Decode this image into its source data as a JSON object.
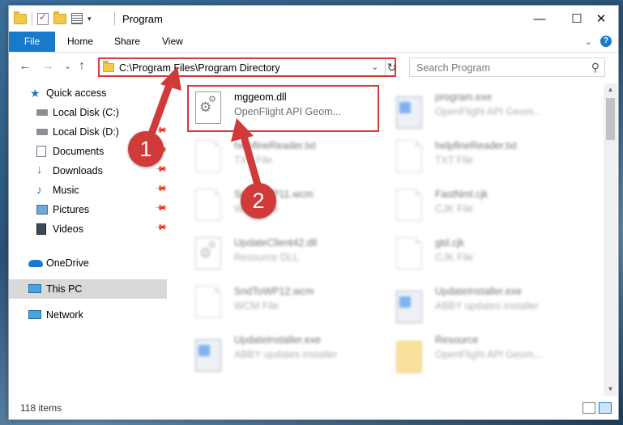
{
  "window": {
    "title": "Program",
    "controls": {
      "minimize": "—",
      "maximize": "☐",
      "close": "✕"
    }
  },
  "ribbon": {
    "tabs": [
      {
        "label": "File"
      },
      {
        "label": "Home"
      },
      {
        "label": "Share"
      },
      {
        "label": "View"
      }
    ],
    "help": "?"
  },
  "nav": {
    "back": "←",
    "forward": "→",
    "recent": "⌄",
    "up": "↑",
    "address": "C:\\Program Files\\Program Directory",
    "search_placeholder": "Search Program"
  },
  "sidebar": {
    "items": [
      {
        "label": "Quick access",
        "icon": "star-icon"
      },
      {
        "label": "Local Disk (C:)",
        "icon": "drive-icon"
      },
      {
        "label": "Local Disk (D:)",
        "icon": "drive-icon"
      },
      {
        "label": "Documents",
        "icon": "documents-icon"
      },
      {
        "label": "Downloads",
        "icon": "downloads-icon"
      },
      {
        "label": "Music",
        "icon": "music-icon"
      },
      {
        "label": "Pictures",
        "icon": "pictures-icon"
      },
      {
        "label": "Videos",
        "icon": "videos-icon"
      },
      {
        "label": "OneDrive",
        "icon": "onedrive-icon"
      },
      {
        "label": "This PC",
        "icon": "pc-icon"
      },
      {
        "label": "Network",
        "icon": "network-icon"
      }
    ]
  },
  "files": [
    {
      "name": "mggeom.dll",
      "type": "OpenFlight API Geom..."
    },
    {
      "name": "program.exe",
      "type": "OpenFlight API Geom..."
    },
    {
      "name": "helpfineReader.txt",
      "type": "TXT File"
    },
    {
      "name": "helpfineReader.txt",
      "type": "TXT File"
    },
    {
      "name": "SndToWP11.wcm",
      "type": "WCM File"
    },
    {
      "name": "FastNml.cjk",
      "type": "CJK File"
    },
    {
      "name": "UpdateClient42.dll",
      "type": "Resource DLL"
    },
    {
      "name": "gtd.cjk",
      "type": "CJK File"
    },
    {
      "name": "SndToWP12.wcm",
      "type": "WCM File"
    },
    {
      "name": "UpdateInstaller.exe",
      "type": "ABBY updates installer"
    },
    {
      "name": "UpdateInstaller.exe",
      "type": "ABBY updates installer"
    },
    {
      "name": "Resource",
      "type": "OpenFlight API Geom..."
    }
  ],
  "status": {
    "items_count": "118 items"
  },
  "annotations": {
    "step1": "1",
    "step2": "2"
  },
  "colors": {
    "accent": "#1979ca",
    "highlight": "#d93a3a",
    "badge": "#d23a3a"
  }
}
